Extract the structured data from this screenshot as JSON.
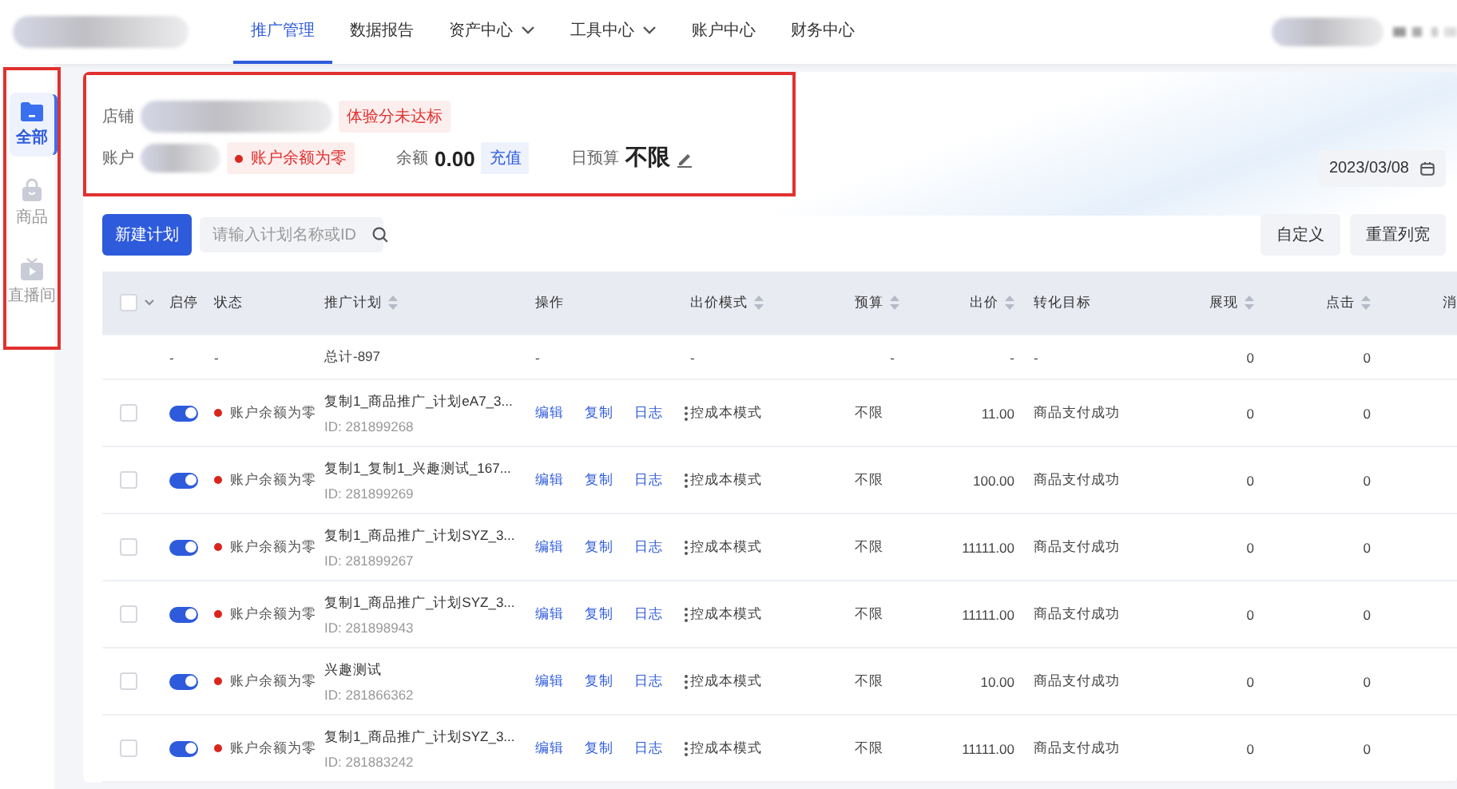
{
  "nav": {
    "items": [
      {
        "label": "推广管理",
        "selected": true,
        "dropdown": false
      },
      {
        "label": "数据报告",
        "selected": false,
        "dropdown": false
      },
      {
        "label": "资产中心",
        "selected": false,
        "dropdown": true
      },
      {
        "label": "工具中心",
        "selected": false,
        "dropdown": true
      },
      {
        "label": "账户中心",
        "selected": false,
        "dropdown": false
      },
      {
        "label": "财务中心",
        "selected": false,
        "dropdown": false
      }
    ]
  },
  "sidebar": {
    "highlighted": true,
    "items": [
      {
        "label": "全部",
        "kind": "folder",
        "selected": true
      },
      {
        "label": "商品",
        "kind": "bag",
        "selected": false
      },
      {
        "label": "直播间",
        "kind": "tv",
        "selected": false
      }
    ]
  },
  "summary": {
    "highlighted": true,
    "shop_label": "店铺",
    "shop_badge": "体验分未达标",
    "account_label": "账户",
    "account_status": "账户余额为零",
    "balance_label": "余额",
    "balance": "0.00",
    "recharge_button": "充值",
    "budget_label": "日预算",
    "budget": "不限",
    "date": "2023/03/08"
  },
  "toolbar": {
    "new_button": "新建计划",
    "search": {
      "placeholder": "请输入计划名称或ID"
    },
    "buttons": [
      "自定义",
      "重置列宽"
    ]
  },
  "table": {
    "select_all_checked": false,
    "columns": [
      {
        "label": "启停",
        "sortable": false
      },
      {
        "label": "状态",
        "sortable": false
      },
      {
        "label": "推广计划",
        "sortable": true
      },
      {
        "label": "操作",
        "sortable": false
      },
      {
        "label": "出价模式",
        "sortable": true
      },
      {
        "label": "预算",
        "sortable": true
      },
      {
        "label": "出价",
        "sortable": true
      },
      {
        "label": "转化目标",
        "sortable": false
      },
      {
        "label": "展现",
        "sortable": true
      },
      {
        "label": "点击",
        "sortable": true
      },
      {
        "label": "消",
        "sortable": false
      }
    ],
    "total_row": [
      "-",
      "-",
      "总计-897",
      "-",
      "-",
      "-",
      "-",
      "-",
      "0",
      "0"
    ],
    "rows": [
      {
        "checked": false,
        "on": true,
        "status": "账户余额为零",
        "plan": "复制1_商品推广_计划eA7_3...",
        "id": "ID: 281899268",
        "actions": [
          "编辑",
          "复制",
          "日志"
        ],
        "mode": "控成本模式",
        "budget": "不限",
        "bid": "11.00",
        "target": "商品支付成功",
        "impressions": "0",
        "clicks": "0"
      },
      {
        "checked": false,
        "on": true,
        "status": "账户余额为零",
        "plan": "复制1_复制1_兴趣测试_167...",
        "id": "ID: 281899269",
        "actions": [
          "编辑",
          "复制",
          "日志"
        ],
        "mode": "控成本模式",
        "budget": "不限",
        "bid": "100.00",
        "target": "商品支付成功",
        "impressions": "0",
        "clicks": "0"
      },
      {
        "checked": false,
        "on": true,
        "status": "账户余额为零",
        "plan": "复制1_商品推广_计划SYZ_3...",
        "id": "ID: 281899267",
        "actions": [
          "编辑",
          "复制",
          "日志"
        ],
        "mode": "控成本模式",
        "budget": "不限",
        "bid": "11111.00",
        "target": "商品支付成功",
        "impressions": "0",
        "clicks": "0"
      },
      {
        "checked": false,
        "on": true,
        "status": "账户余额为零",
        "plan": "复制1_商品推广_计划SYZ_3...",
        "id": "ID: 281898943",
        "actions": [
          "编辑",
          "复制",
          "日志"
        ],
        "mode": "控成本模式",
        "budget": "不限",
        "bid": "11111.00",
        "target": "商品支付成功",
        "impressions": "0",
        "clicks": "0"
      },
      {
        "checked": false,
        "on": true,
        "status": "账户余额为零",
        "plan": "兴趣测试",
        "id": "ID: 281866362",
        "actions": [
          "编辑",
          "复制",
          "日志"
        ],
        "mode": "控成本模式",
        "budget": "不限",
        "bid": "10.00",
        "target": "商品支付成功",
        "impressions": "0",
        "clicks": "0"
      },
      {
        "checked": false,
        "on": true,
        "status": "账户余额为零",
        "plan": "复制1_商品推广_计划SYZ_3...",
        "id": "ID: 281883242",
        "actions": [
          "编辑",
          "复制",
          "日志"
        ],
        "mode": "控成本模式",
        "budget": "不限",
        "bid": "11111.00",
        "target": "商品支付成功",
        "impressions": "0",
        "clicks": "0"
      }
    ]
  }
}
